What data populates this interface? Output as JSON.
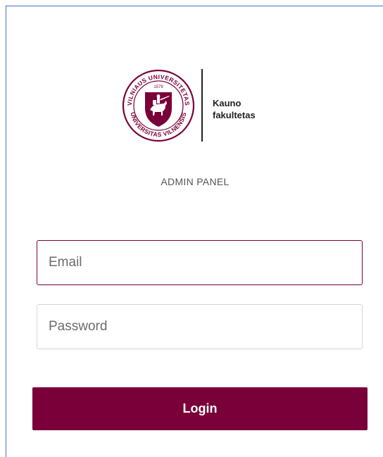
{
  "logo": {
    "seal_top_text": "VILNIAUS UNIVERSITETAS",
    "seal_bottom_text": "UNIVERSITAS VILNENSIS",
    "seal_year": "1579",
    "faculty_line1": "Kauno",
    "faculty_line2": "fakultetas",
    "brand_color": "#7a0039"
  },
  "panel_title": "ADMIN PANEL",
  "form": {
    "email_placeholder": "Email",
    "email_value": "",
    "password_placeholder": "Password",
    "password_value": "",
    "login_label": "Login"
  },
  "colors": {
    "accent": "#7a0039",
    "frame_border": "#4472c4",
    "input_border": "#d6d6d6"
  }
}
